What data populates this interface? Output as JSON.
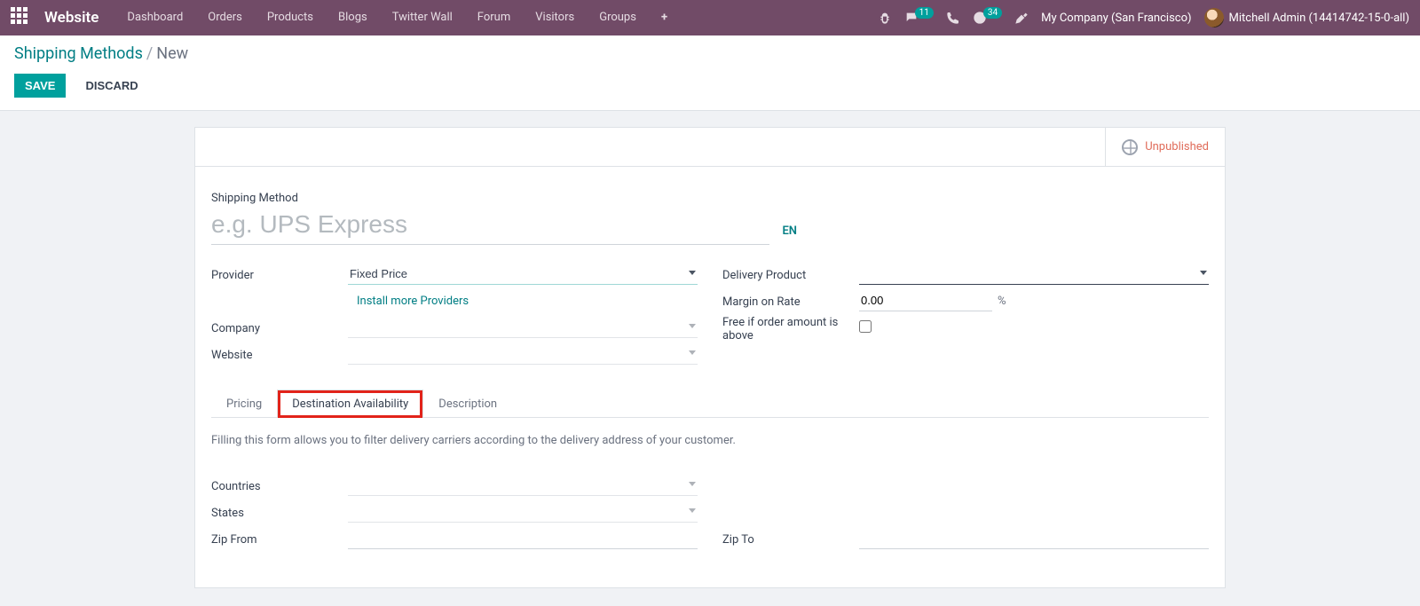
{
  "navbar": {
    "brand": "Website",
    "items": [
      "Dashboard",
      "Orders",
      "Products",
      "Blogs",
      "Twitter Wall",
      "Forum",
      "Visitors",
      "Groups"
    ],
    "messages_count": "11",
    "activities_count": "34",
    "company": "My Company (San Francisco)",
    "user": "Mitchell Admin (14414742-15-0-all)"
  },
  "breadcrumb": {
    "parent": "Shipping Methods",
    "current": "New"
  },
  "actions": {
    "save": "SAVE",
    "discard": "DISCARD"
  },
  "status": {
    "publish": "Unpublished"
  },
  "title": {
    "label": "Shipping Method",
    "placeholder": "e.g. UPS Express",
    "value": "",
    "lang": "EN"
  },
  "form": {
    "provider": {
      "label": "Provider",
      "value": "Fixed Price"
    },
    "install_more": "Install more Providers",
    "company": {
      "label": "Company",
      "value": ""
    },
    "website": {
      "label": "Website",
      "value": ""
    },
    "delivery_product": {
      "label": "Delivery Product",
      "value": ""
    },
    "margin": {
      "label": "Margin on Rate",
      "value": "0.00",
      "unit": "%"
    },
    "free_if": {
      "label": "Free if order amount is above",
      "checked": false
    }
  },
  "tabs": {
    "pricing": "Pricing",
    "dest": "Destination Availability",
    "desc": "Description",
    "active": "dest"
  },
  "dest_tab": {
    "help": "Filling this form allows you to filter delivery carriers according to the delivery address of your customer.",
    "countries": {
      "label": "Countries",
      "value": ""
    },
    "states": {
      "label": "States",
      "value": ""
    },
    "zip_from": {
      "label": "Zip From",
      "value": ""
    },
    "zip_to": {
      "label": "Zip To",
      "value": ""
    }
  }
}
